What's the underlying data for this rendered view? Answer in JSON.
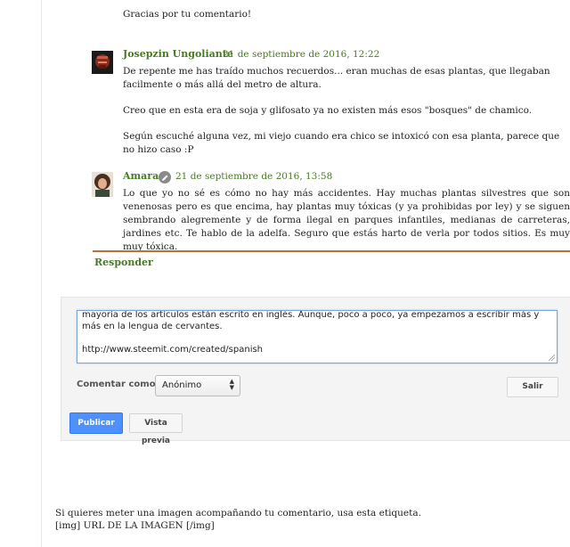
{
  "top_reply": "Gracias por tu comentario!",
  "comments": [
    {
      "author": "Josepzin Ungoliante",
      "date": "21 de septiembre de 2016, 12:22",
      "paragraphs": [
        "De repente me has traído muchos recuerdos... eran muchas de esas plantas, que llegaban facilmente o más allá del metro de altura.",
        "Creo que en esta era de soja y glifosato ya no existen más esos \"bosques\" de chamico.",
        "Según escuché alguna vez, mi viejo cuando era chico se intoxicó con esa planta, parece que no hizo caso :P"
      ]
    },
    {
      "author": "Amara",
      "date": "21 de septiembre de 2016, 13:58",
      "paragraphs": [
        "Lo que yo no sé es cómo no hay más accidentes. Hay muchas plantas silvestres que son venenosas pero es que encima, hay plantas muy tóxicas (y ya prohibidas por ley) y se siguen sembrando alegremente y de forma ilegal en parques infantiles, medianas de carreteras, jardines etc. Te hablo de la adelfa. Seguro que estás harto de verla por todos sitios. Es muy muy tóxica."
      ]
    }
  ],
  "reply_link": "Responder",
  "form": {
    "textarea_value": "mayoría de los artículos están escrito en inglés. Aunque, poco a poco, ya empezamos a escribir más y más en la lengua de cervantes.\n\nhttp://www.steemit.com/created/spanish",
    "comment_as_label": "Comentar como:",
    "comment_as_value": "Anónimo",
    "logout_label": "Salir",
    "publish_label": "Publicar",
    "preview_label": "Vista previa"
  },
  "footer": {
    "line1": "Si quieres meter una imagen acompañando tu comentario, usa esta etiqueta.",
    "line2": "[img] URL DE LA IMAGEN [/img]"
  },
  "colors": {
    "author_green": "#4a7a24",
    "divider_brown": "#b7743a",
    "publish_blue": "#4d90fe"
  },
  "icons": {
    "edit_badge": "pencil-icon",
    "select_arrows": "updown-arrows-icon"
  }
}
